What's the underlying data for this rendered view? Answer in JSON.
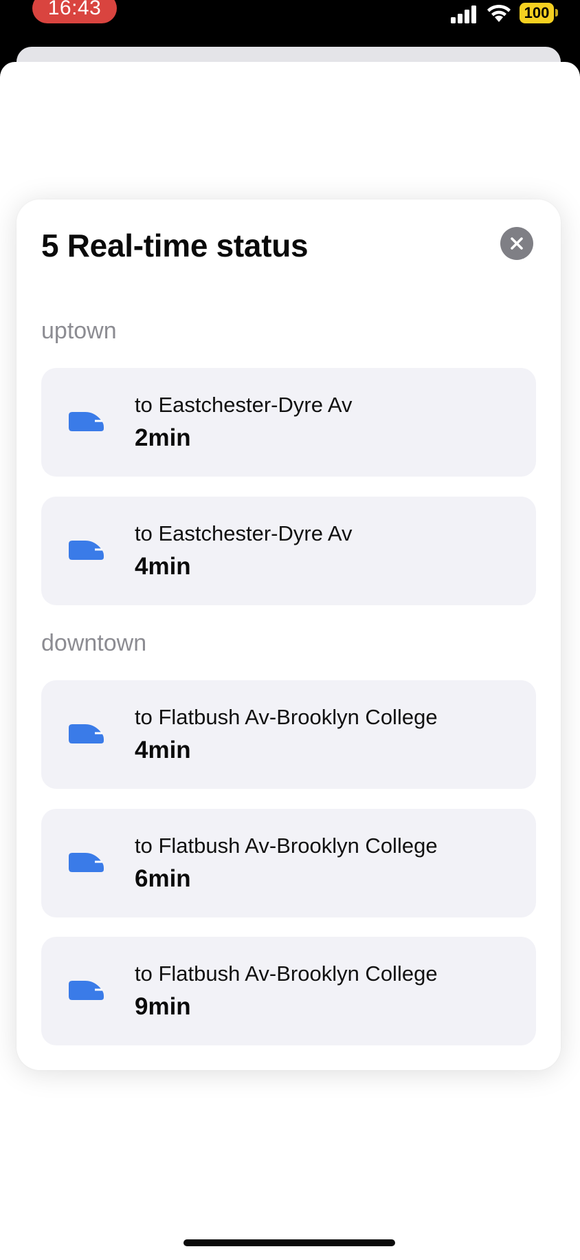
{
  "status_bar": {
    "time": "16:43",
    "battery": "100",
    "time_pill_color": "#d9443f",
    "battery_color": "#f5d020"
  },
  "modal": {
    "title": "5 Real-time status",
    "close_icon": "close-icon"
  },
  "sections": [
    {
      "label": "uptown",
      "trains": [
        {
          "destination": "to Eastchester-Dyre Av",
          "eta": "2min"
        },
        {
          "destination": "to Eastchester-Dyre Av",
          "eta": "4min"
        }
      ]
    },
    {
      "label": "downtown",
      "trains": [
        {
          "destination": "to Flatbush Av-Brooklyn College",
          "eta": "4min"
        },
        {
          "destination": "to Flatbush Av-Brooklyn College",
          "eta": "6min"
        },
        {
          "destination": "to Flatbush Av-Brooklyn College",
          "eta": "9min"
        }
      ]
    }
  ],
  "colors": {
    "train_icon": "#3a7be8",
    "row_background": "#f2f2f7",
    "section_label": "#8c8c92"
  }
}
